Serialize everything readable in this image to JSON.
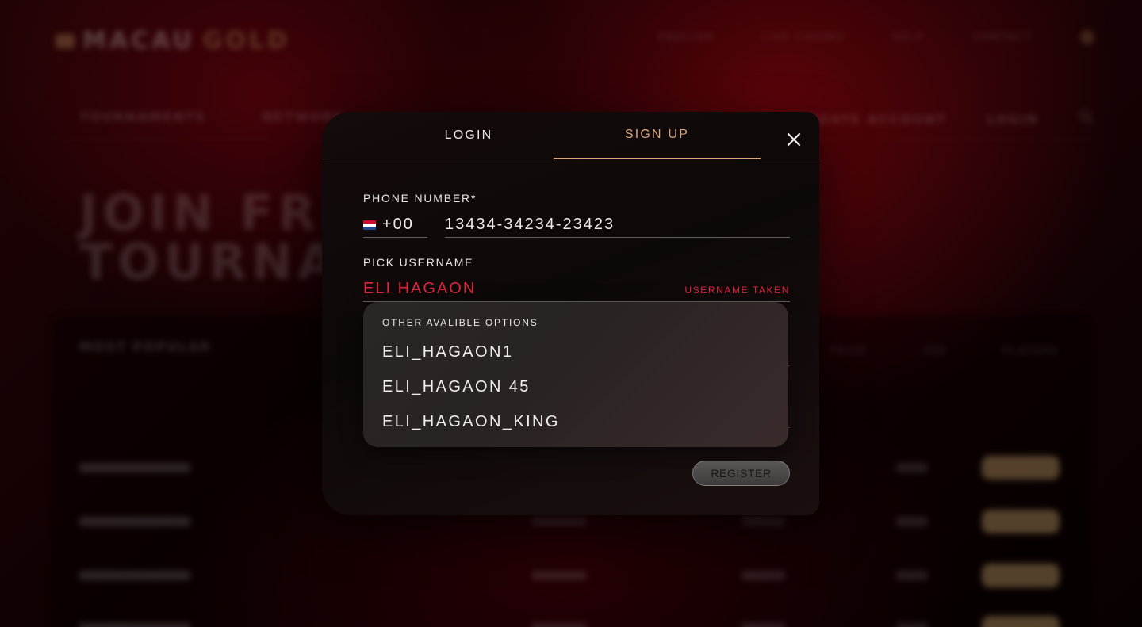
{
  "background": {
    "brand_left": "MACAU",
    "brand_right": "GOLD",
    "top_nav": [
      "ENGLISH",
      "LIVE CASINO",
      "HELP",
      "CONTACT"
    ],
    "section_nav": [
      "TOURNAMENTS",
      "NETWORK"
    ],
    "section_nav_right": [
      "CREATE ACCOUNT",
      "LOGIN"
    ],
    "hero_line1": "JOIN FREE",
    "hero_line2": "TOURNAMENTS",
    "table_title": "MOST POPULAR",
    "table_columns": [
      "PRIZE",
      "FEE",
      "PLAYERS"
    ]
  },
  "modal": {
    "tabs": {
      "login": "LOGIN",
      "signup": "SIGN UP",
      "active": "signup"
    },
    "phone": {
      "label": "PHONE NUMBER*",
      "country_code": "+00",
      "value": "13434-34234-23423",
      "flag_colors": [
        "#c8102e",
        "#ffffff",
        "#21468b"
      ]
    },
    "username": {
      "label": "PICK USERNAME",
      "value": "ELI HAGAON",
      "error": "USERNAME TAKEN",
      "error_color": "#e0263e"
    },
    "suggestions": {
      "title": "OTHER AVALIBLE OPTIONS",
      "options": [
        "ELI_HAGAON1",
        "ELI_HAGAON 45",
        "ELI_HAGAON_KING"
      ]
    },
    "register_label": "REGISTER",
    "accent_color": "#d8a77a"
  }
}
